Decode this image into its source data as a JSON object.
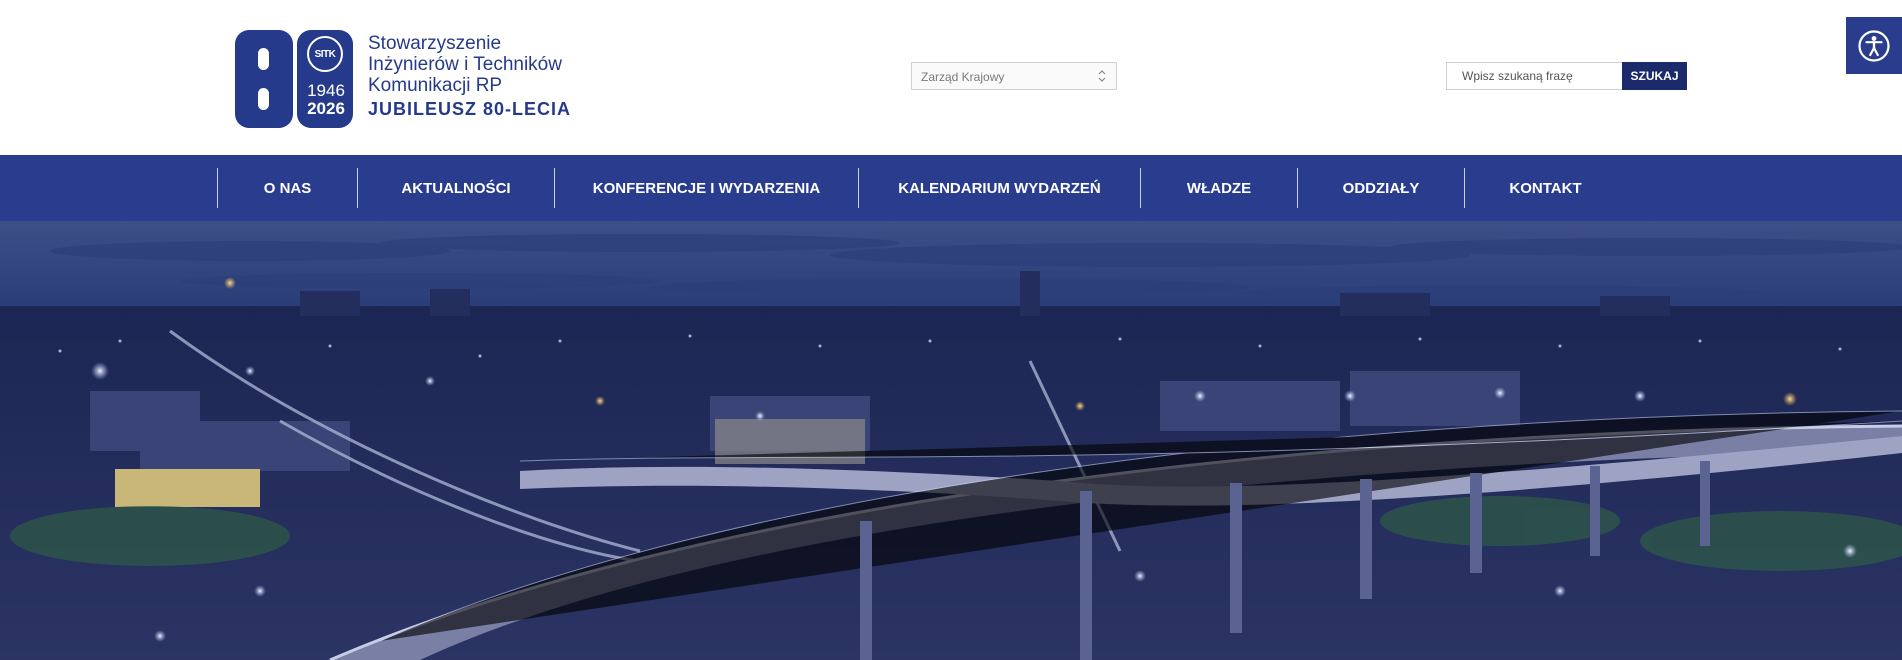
{
  "logo": {
    "lines": [
      "Stowarzyszenie",
      "Inżynierów i Techników",
      "Komunikacji RP"
    ],
    "jubilee": "JUBILEUSZ 80-LECIA",
    "badge": {
      "seal": "SITK",
      "year_start": "1946",
      "year_end": "2026"
    }
  },
  "dept_select": {
    "value": "Zarząd Krajowy"
  },
  "search": {
    "placeholder": "Wpisz szukaną frazę",
    "button": "SZUKAJ"
  },
  "accessibility": {
    "icon": "accessibility-icon"
  },
  "nav": {
    "items": [
      {
        "label": "O NAS"
      },
      {
        "label": "AKTUALNOŚCI"
      },
      {
        "label": "KONFERENCJE I WYDARZENIA"
      },
      {
        "label": "KALENDARIUM WYDARZEŃ"
      },
      {
        "label": "WŁADZE"
      },
      {
        "label": "ODDZIAŁY"
      },
      {
        "label": "KONTAKT"
      }
    ]
  },
  "colors": {
    "brand": "#263a8c",
    "nav_bg": "#2a3c8e",
    "button_bg": "#1b2a6b"
  }
}
